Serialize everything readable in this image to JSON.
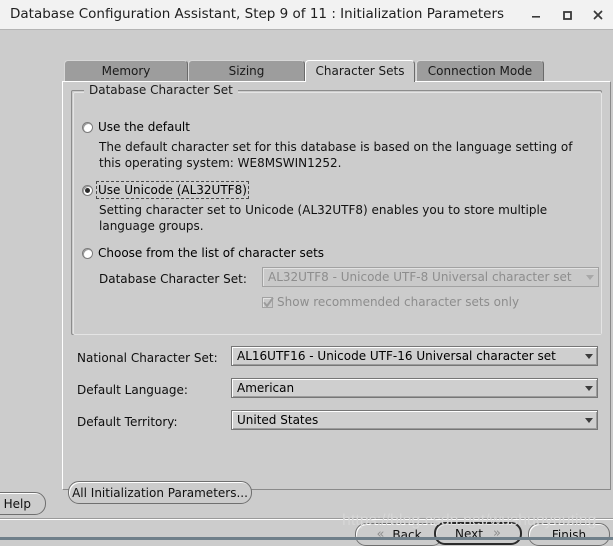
{
  "window": {
    "title": "Database Configuration Assistant, Step 9 of 11 : Initialization Parameters",
    "controls": {
      "minimize": "minimize-icon",
      "maximize": "maximize-icon",
      "close": "close-icon"
    }
  },
  "tabs": [
    {
      "label": "Memory",
      "active": false
    },
    {
      "label": "Sizing",
      "active": false
    },
    {
      "label": "Character Sets",
      "active": true
    },
    {
      "label": "Connection Mode",
      "active": false
    }
  ],
  "group": {
    "title": "Database Character Set",
    "options": [
      {
        "label": "Use the default",
        "selected": false,
        "focused": false,
        "description": "The default character set for this database is based on the language setting of this operating system: WE8MSWIN1252."
      },
      {
        "label": "Use Unicode (AL32UTF8)",
        "selected": true,
        "focused": true,
        "description": "Setting character set to Unicode (AL32UTF8) enables you to store multiple language groups."
      },
      {
        "label": "Choose from the list of character sets",
        "selected": false,
        "focused": false,
        "description": ""
      }
    ],
    "charset_field": {
      "label": "Database Character Set:",
      "value": "AL32UTF8 - Unicode UTF-8 Universal character set",
      "disabled": true
    },
    "recommended_checkbox": {
      "label": "Show recommended character sets only",
      "checked": true,
      "disabled": true
    }
  },
  "fields": [
    {
      "label": "National Character Set:",
      "value": "AL16UTF16 - Unicode UTF-16 Universal character set"
    },
    {
      "label": "Default Language:",
      "value": "American"
    },
    {
      "label": "Default Territory:",
      "value": "United States"
    }
  ],
  "all_params_button": "All Initialization Parameters...",
  "nav": {
    "help": "Help",
    "back": "Back",
    "back_chevron": "«",
    "next": "Next",
    "next_chevron": "»",
    "finish": "Finish"
  },
  "watermark": "https://blog.csdn.net/wushuoyouting",
  "colors": {
    "dialog_bg": "#cccccc",
    "titlebar_bg": "#f2f2f2",
    "tab_inactive": "#9d9d9d",
    "bg_strip_top": "#0000e2",
    "bg_strip_bottom": "#00033f",
    "check_mark": "#c01a1a",
    "watermark": "#d6d6d6"
  }
}
